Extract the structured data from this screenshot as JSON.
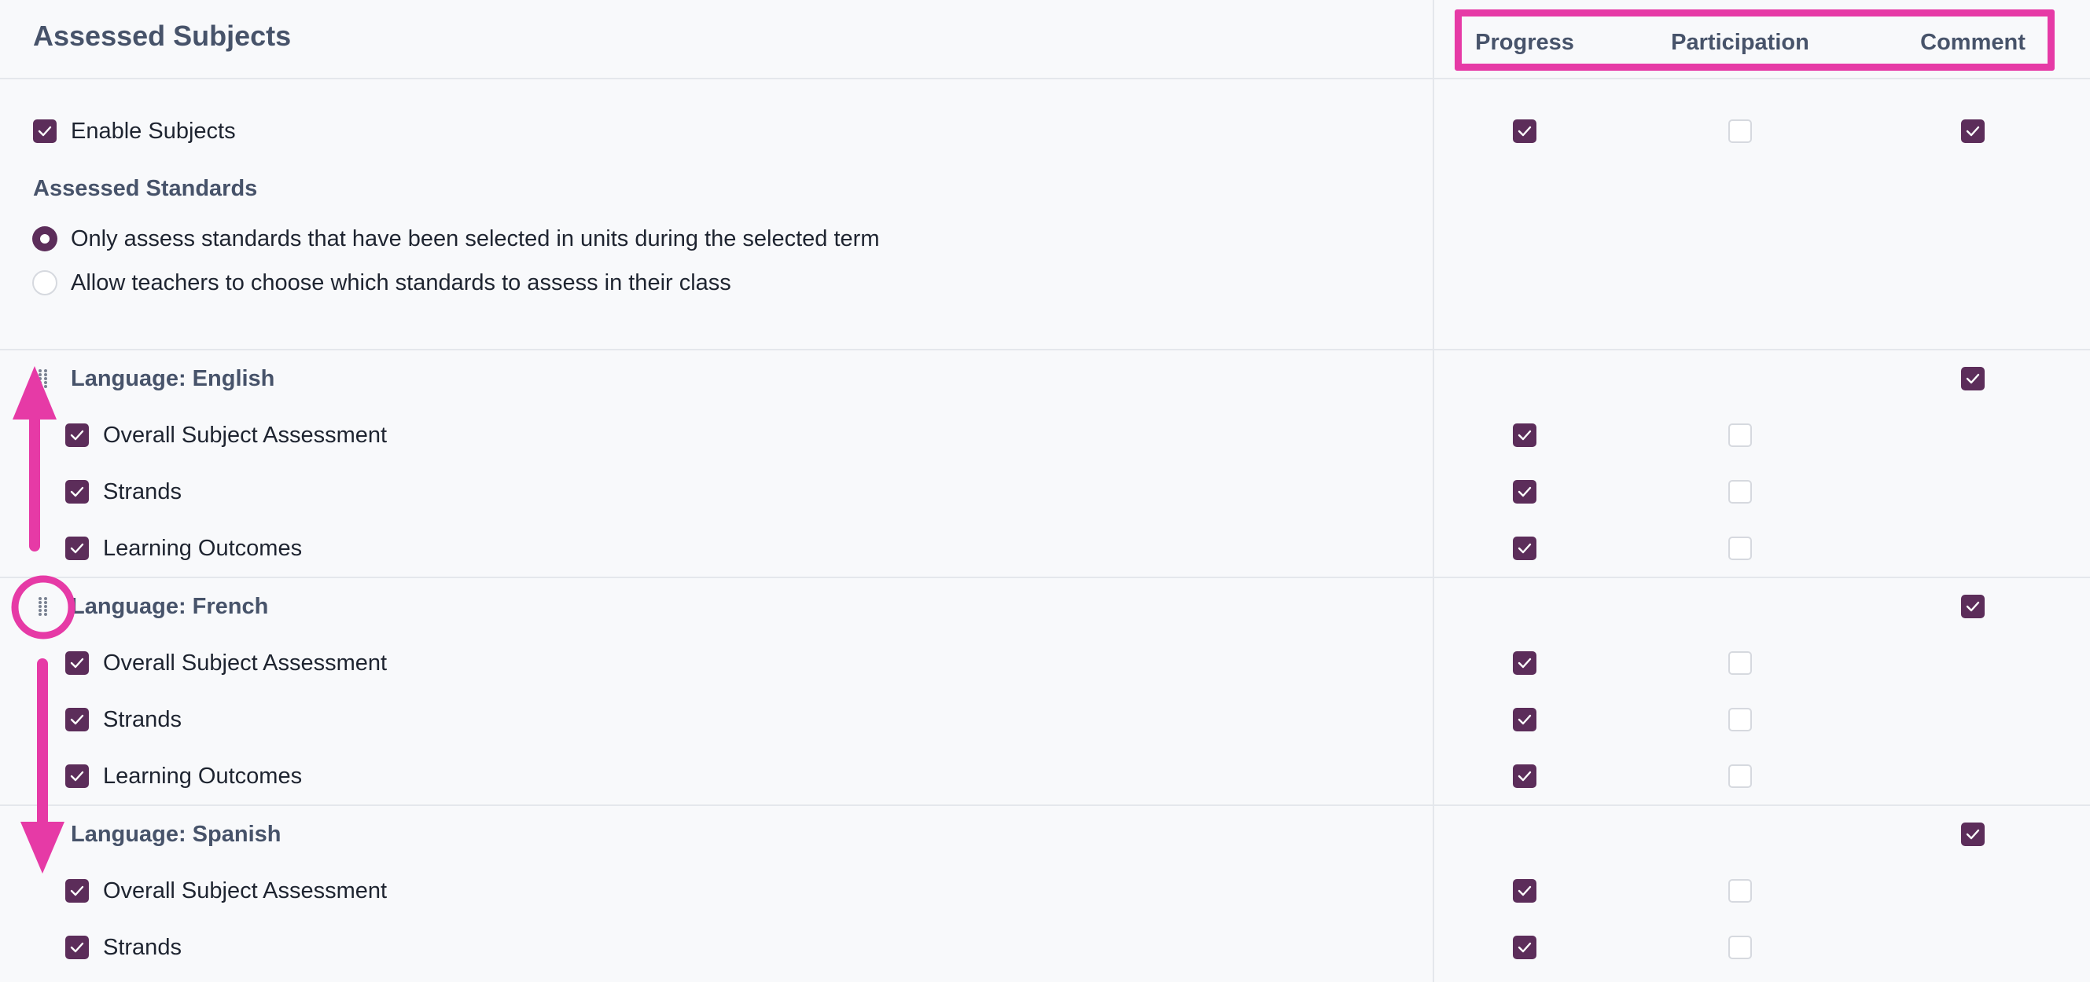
{
  "header": {
    "title": "Assessed Subjects",
    "columns": [
      "Progress",
      "Participation",
      "Comment"
    ]
  },
  "settings": {
    "enable_subjects": {
      "label": "Enable Subjects",
      "checked": true,
      "progress": true,
      "participation": false,
      "comment": true
    },
    "assessed_standards_heading": "Assessed Standards",
    "options": [
      {
        "label": "Only assess standards that have been selected in units during the selected term",
        "selected": true
      },
      {
        "label": "Allow teachers to choose which standards to assess in their class",
        "selected": false
      }
    ]
  },
  "subjects": [
    {
      "name": "Language: English",
      "comment": true,
      "rows": [
        {
          "label": "Overall Subject Assessment",
          "checked": true,
          "progress": true,
          "participation": false
        },
        {
          "label": "Strands",
          "checked": true,
          "progress": true,
          "participation": false
        },
        {
          "label": "Learning Outcomes",
          "checked": true,
          "progress": true,
          "participation": false
        }
      ]
    },
    {
      "name": "Language: French",
      "comment": true,
      "rows": [
        {
          "label": "Overall Subject Assessment",
          "checked": true,
          "progress": true,
          "participation": false
        },
        {
          "label": "Strands",
          "checked": true,
          "progress": true,
          "participation": false
        },
        {
          "label": "Learning Outcomes",
          "checked": true,
          "progress": true,
          "participation": false
        }
      ]
    },
    {
      "name": "Language: Spanish",
      "comment": true,
      "rows": [
        {
          "label": "Overall Subject Assessment",
          "checked": true,
          "progress": true,
          "participation": false
        },
        {
          "label": "Strands",
          "checked": true,
          "progress": true,
          "participation": false
        }
      ]
    }
  ],
  "colors": {
    "accent": "#5c2d5a",
    "annotation": "#e63aa6",
    "heading": "#47536a"
  },
  "icons": [
    "checkmark-icon",
    "drag-handle-icon",
    "arrow-up-annotation",
    "arrow-down-annotation"
  ]
}
